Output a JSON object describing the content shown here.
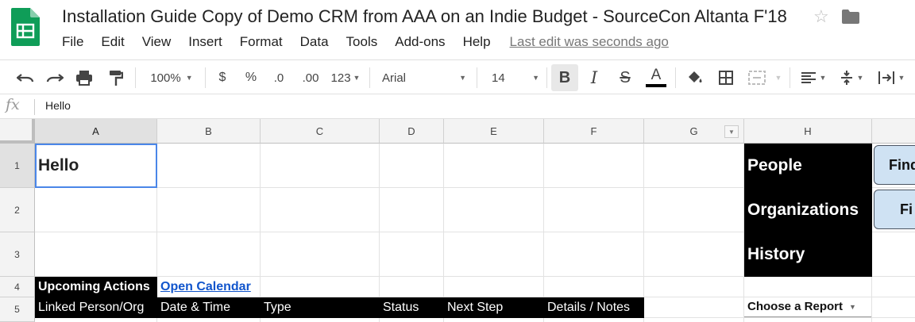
{
  "document": {
    "title": "Installation Guide Copy of Demo CRM from AAA on an Indie Budget - SourceCon Altanta F'18",
    "last_edit": "Last edit was seconds ago"
  },
  "menu": [
    "File",
    "Edit",
    "View",
    "Insert",
    "Format",
    "Data",
    "Tools",
    "Add-ons",
    "Help"
  ],
  "toolbar": {
    "zoom": "100%",
    "currency": "$",
    "percent": "%",
    "decrease_decimal": ".0",
    "increase_decimal": ".00",
    "more_formats": "123",
    "font": "Arial",
    "font_size": "14",
    "bold": "B",
    "italic": "I",
    "strike": "S",
    "text_color": "A"
  },
  "formula_bar": {
    "fx": "fx",
    "value": "Hello"
  },
  "columns": [
    "A",
    "B",
    "C",
    "D",
    "E",
    "F",
    "G",
    "H"
  ],
  "rows": [
    "1",
    "2",
    "3",
    "4",
    "5"
  ],
  "cells": {
    "a1": "Hello",
    "a4": "Upcoming Actions",
    "b4": "Open Calendar",
    "a5": "Linked Person/Org",
    "b5": "Date & Time",
    "c5": "Type",
    "d5": "Status",
    "e5": "Next Step",
    "f5": "Details / Notes",
    "h1": "People",
    "h2": "Organizations",
    "h3": "History",
    "h5": "Choose a Report"
  },
  "buttons": {
    "find1": "Find",
    "find2": "Fi"
  },
  "colors": {
    "selection": "#4a86e8",
    "link": "#1155cc",
    "button_fill": "#cfe2f3",
    "sheets_green": "#0f9d58"
  }
}
